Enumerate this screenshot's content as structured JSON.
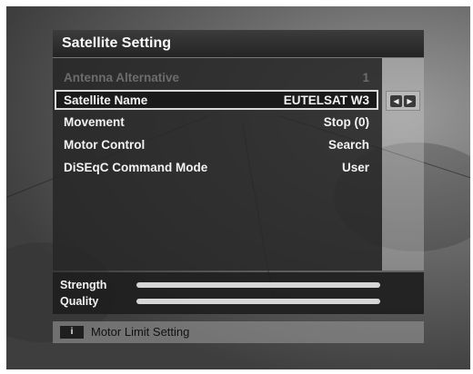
{
  "title": "Satellite Setting",
  "menu": [
    {
      "label": "Antenna Alternative",
      "value": "1",
      "state": "disabled"
    },
    {
      "label": "Satellite Name",
      "value": "EUTELSAT W3",
      "state": "selected"
    },
    {
      "label": "Movement",
      "value": "Stop (0)",
      "state": "normal"
    },
    {
      "label": "Motor Control",
      "value": "Search",
      "state": "normal"
    },
    {
      "label": "DiSEqC Command Mode",
      "value": "User",
      "state": "normal"
    }
  ],
  "selector_hint": {
    "left_icon": "left-arrow-icon",
    "right_icon": "right-arrow-icon",
    "left_glyph": "◀",
    "right_glyph": "▶"
  },
  "signal": {
    "strength_label": "Strength",
    "quality_label": "Quality"
  },
  "footer": {
    "key": "i",
    "label": "Motor Limit Setting"
  }
}
